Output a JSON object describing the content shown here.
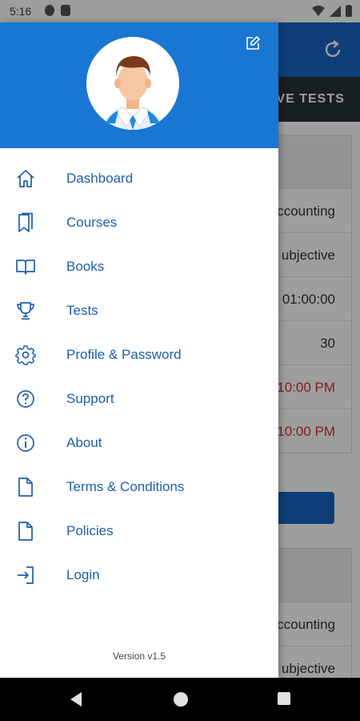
{
  "status_bar": {
    "time": "5:16"
  },
  "background_app": {
    "tab_label": "IVE TESTS",
    "card1_rows": [
      "ccounting",
      "ubjective",
      "01:00:00",
      "30",
      "10:00 PM",
      "10:00 PM"
    ],
    "card2_rows": [
      "ccounting",
      "ubjective"
    ]
  },
  "drawer": {
    "menu": [
      {
        "label": "Dashboard",
        "icon": "home-icon"
      },
      {
        "label": "Courses",
        "icon": "bookmarks-icon"
      },
      {
        "label": "Books",
        "icon": "book-open-icon"
      },
      {
        "label": "Tests",
        "icon": "trophy-icon"
      },
      {
        "label": "Profile & Password",
        "icon": "gear-icon"
      },
      {
        "label": "Support",
        "icon": "help-circle-icon"
      },
      {
        "label": "About",
        "icon": "info-icon"
      },
      {
        "label": "Terms & Conditions",
        "icon": "document-icon"
      },
      {
        "label": "Policies",
        "icon": "document-icon"
      },
      {
        "label": "Login",
        "icon": "login-icon"
      }
    ],
    "version": "Version v1.5"
  },
  "colors": {
    "primary": "#1976d2",
    "menu_text": "#1e5fa8",
    "tab_bar": "#263238",
    "danger": "#d32f2f"
  }
}
